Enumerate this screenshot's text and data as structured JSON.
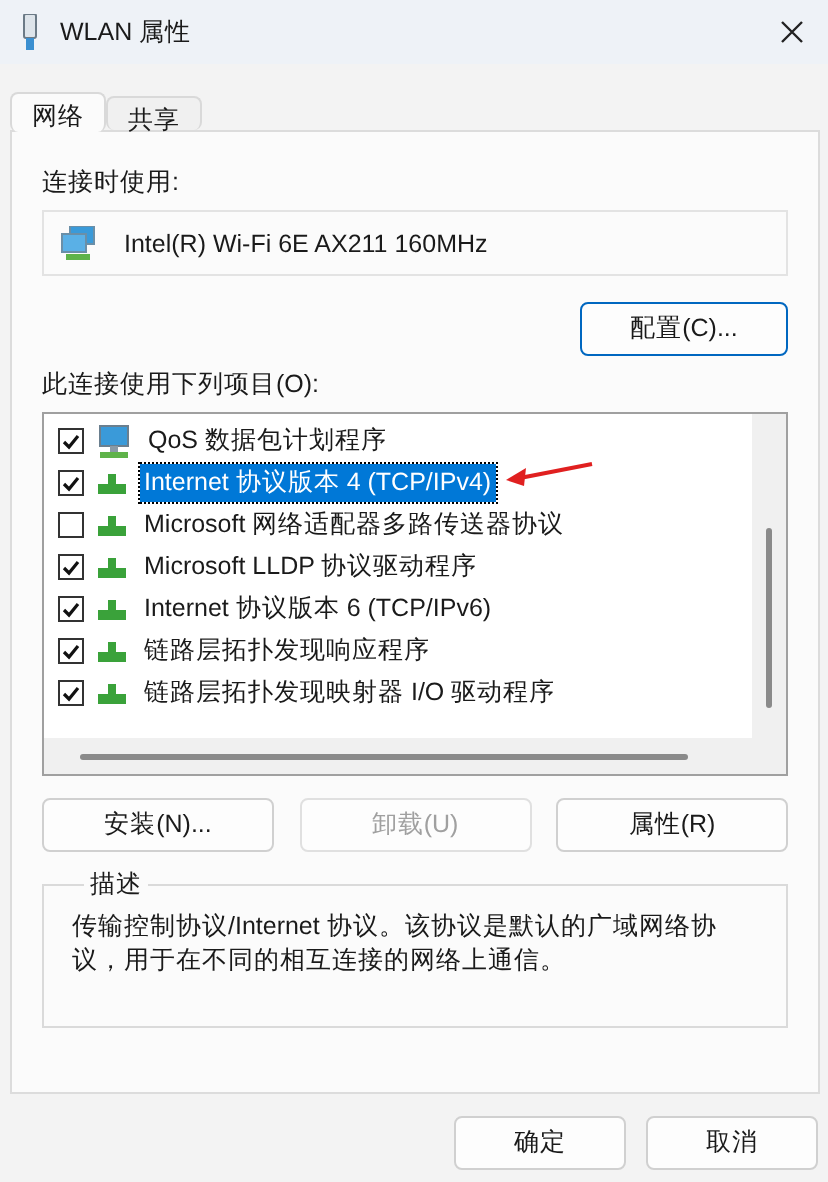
{
  "window": {
    "title": "WLAN 属性"
  },
  "tabs": [
    {
      "label": "网络",
      "selected": true
    },
    {
      "label": "共享",
      "selected": false
    }
  ],
  "connect_using": {
    "label": "连接时使用:",
    "adapter": "Intel(R) Wi-Fi 6E AX211 160MHz",
    "configure_button": "配置(C)..."
  },
  "items_label": "此连接使用下列项目(O):",
  "items": [
    {
      "kind": "service",
      "label": "QoS 数据包计划程序",
      "checked": true,
      "selected": false
    },
    {
      "kind": "protocol",
      "label": "Internet 协议版本 4 (TCP/IPv4)",
      "checked": true,
      "selected": true
    },
    {
      "kind": "protocol",
      "label": "Microsoft 网络适配器多路传送器协议",
      "checked": false,
      "selected": false
    },
    {
      "kind": "protocol",
      "label": "Microsoft LLDP 协议驱动程序",
      "checked": true,
      "selected": false
    },
    {
      "kind": "protocol",
      "label": "Internet 协议版本 6 (TCP/IPv6)",
      "checked": true,
      "selected": false
    },
    {
      "kind": "protocol",
      "label": "链路层拓扑发现响应程序",
      "checked": true,
      "selected": false
    },
    {
      "kind": "protocol",
      "label": "链路层拓扑发现映射器 I/O 驱动程序",
      "checked": true,
      "selected": false
    }
  ],
  "item_buttons": [
    {
      "label": "安装(N)...",
      "disabled": false
    },
    {
      "label": "卸载(U)",
      "disabled": true
    },
    {
      "label": "属性(R)",
      "disabled": false
    }
  ],
  "description": {
    "title": "描述",
    "text": "传输控制协议/Internet 协议。该协议是默认的广域网络协议，用于在不同的相互连接的网络上通信。"
  },
  "dialog_buttons": [
    "确定",
    "取消"
  ]
}
